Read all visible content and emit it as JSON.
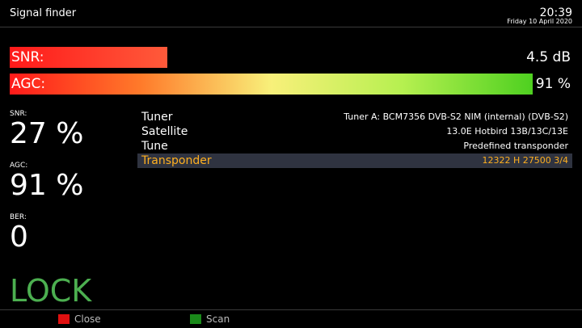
{
  "header": {
    "title": "Signal finder",
    "time": "20:39",
    "date": "Friday 10 April 2020"
  },
  "bars": {
    "snr": {
      "label": "SNR:",
      "value": "4.5 dB",
      "fill_fraction": 0.28
    },
    "agc": {
      "label": "AGC:",
      "value": "91 %",
      "fill_fraction": 0.93
    }
  },
  "stats": {
    "snr_label": "SNR:",
    "snr_value": "27 %",
    "agc_label": "AGC:",
    "agc_value": "91 %",
    "ber_label": "BER:",
    "ber_value": "0",
    "lock_status": "LOCK"
  },
  "info": [
    {
      "key": "Tuner",
      "value": "Tuner A: BCM7356 DVB-S2 NIM (internal) (DVB-S2)",
      "selected": false
    },
    {
      "key": "Satellite",
      "value": "13.0E Hotbird 13B/13C/13E",
      "selected": false
    },
    {
      "key": "Tune",
      "value": "Predefined transponder",
      "selected": false
    },
    {
      "key": "Transponder",
      "value": "12322 H 27500 3/4",
      "selected": true
    }
  ],
  "footer": {
    "close_label": "Close",
    "scan_label": "Scan",
    "close_color": "#e01010",
    "scan_color": "#1a8a1a"
  },
  "colors": {
    "lock": "#4caf50",
    "selected_text": "#ffb020",
    "selected_bg": "#2f3340"
  }
}
